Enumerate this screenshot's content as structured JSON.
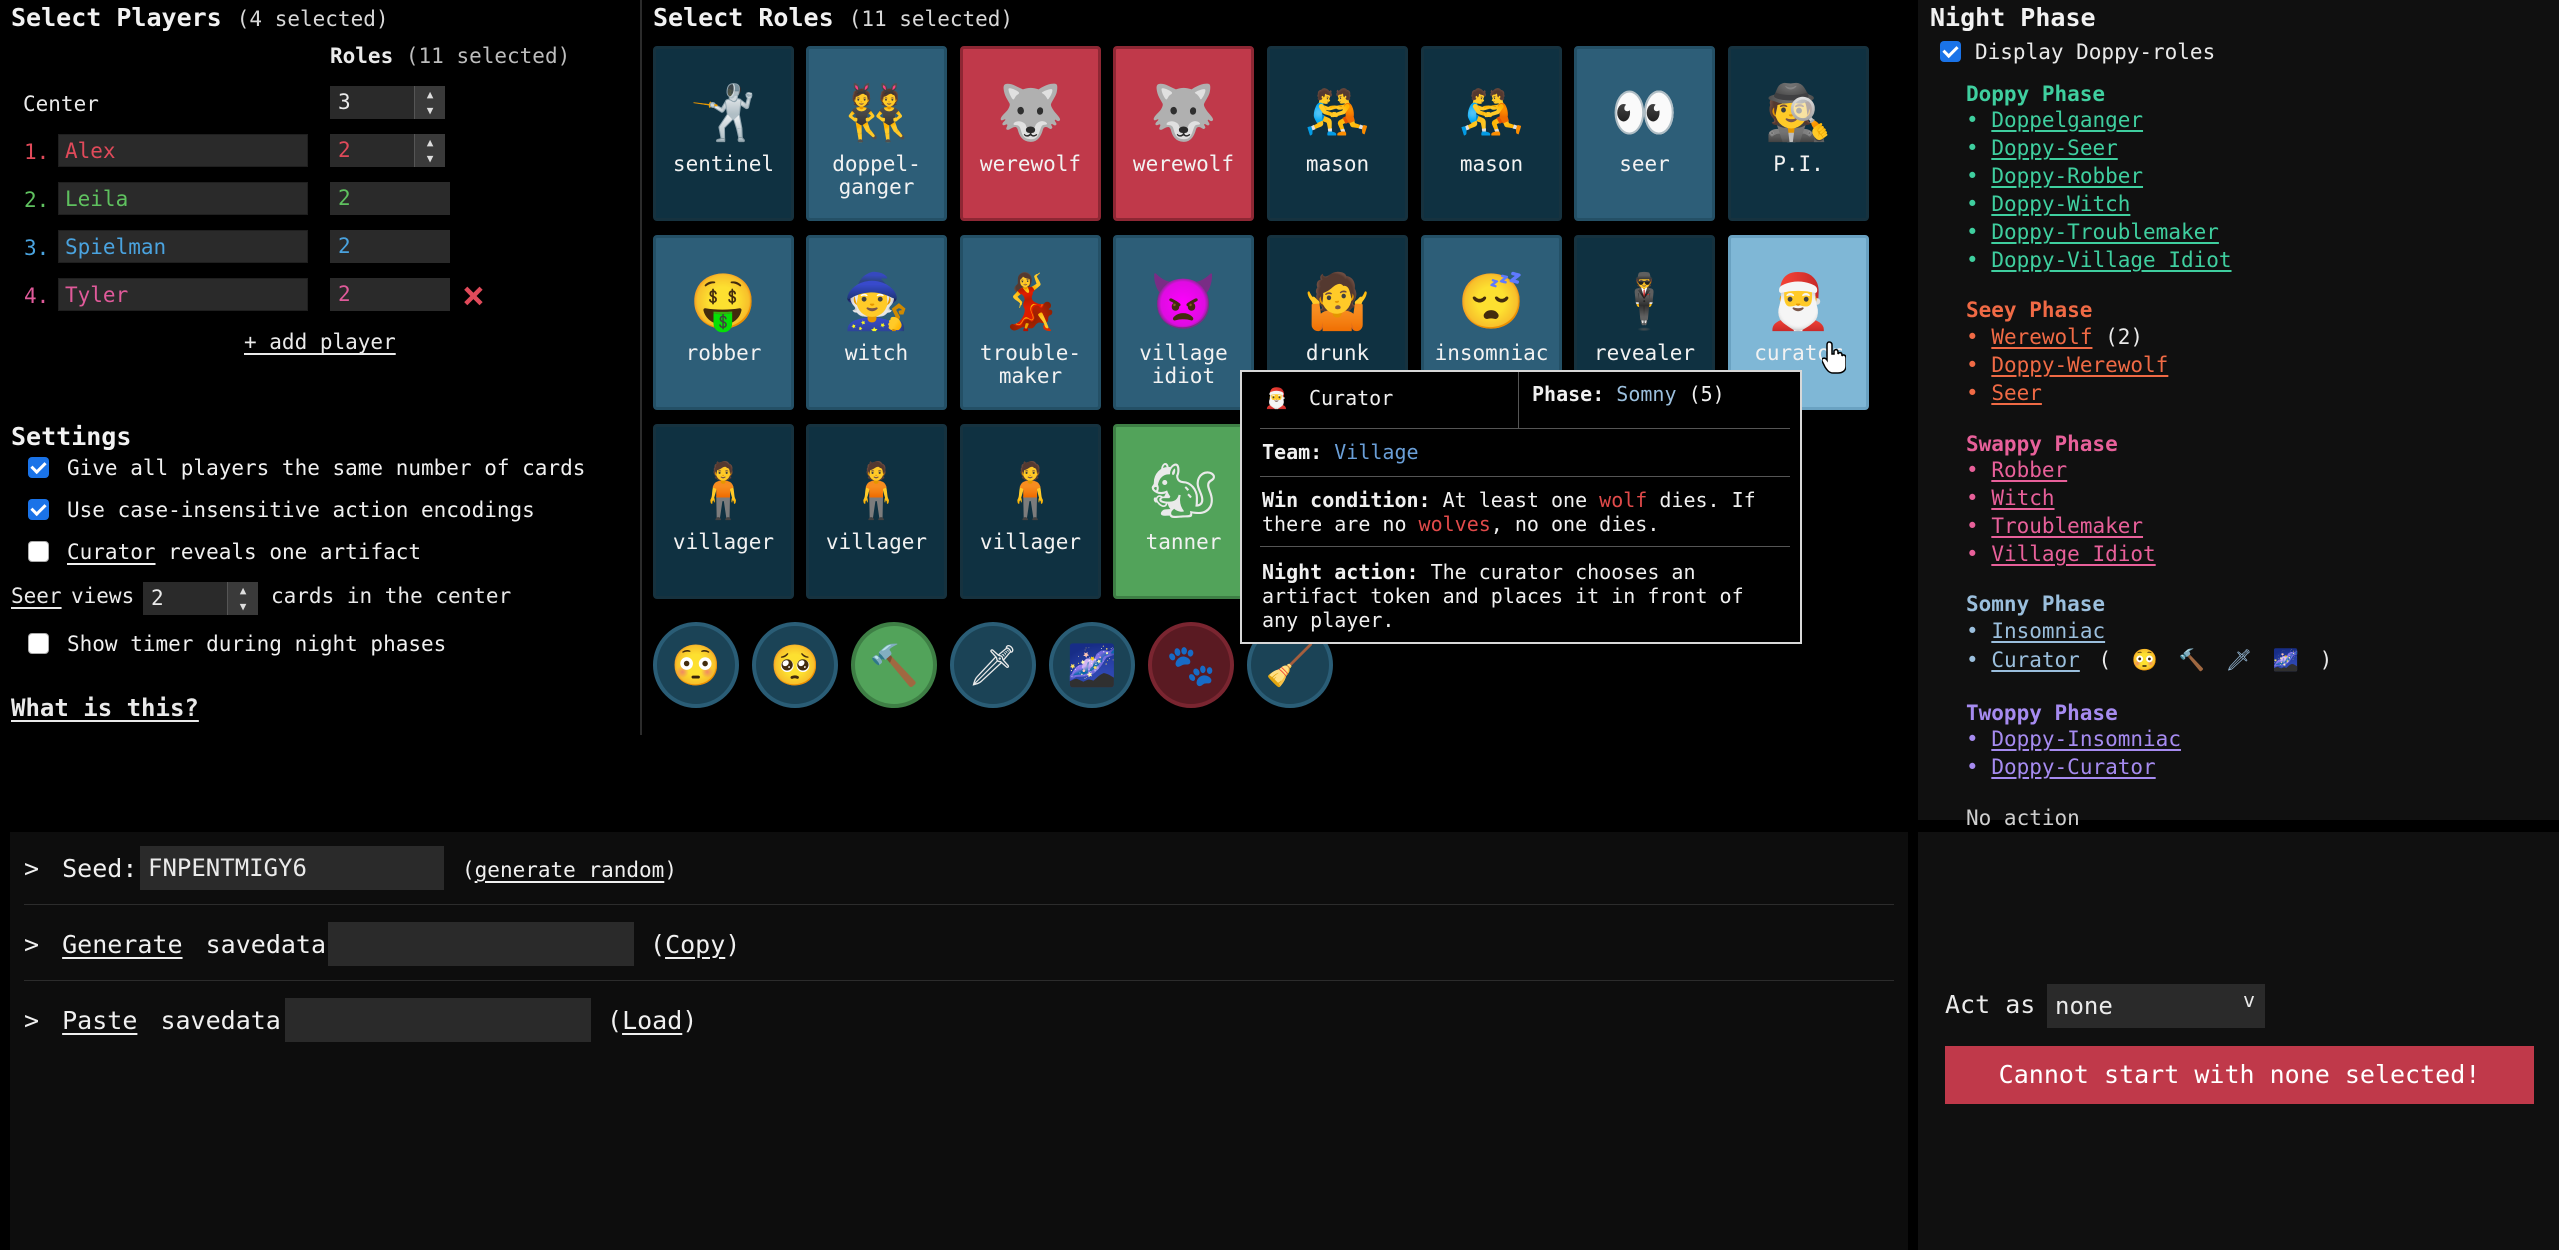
{
  "players": {
    "title": "Select Players",
    "count": "(4 selected)",
    "roles_header": "Roles",
    "roles_count": "(11 selected)",
    "center_label": "Center",
    "center_value": "3",
    "list": [
      {
        "num": "1.",
        "name": "Alex",
        "roles": "2",
        "color": "#e04a5a"
      },
      {
        "num": "2.",
        "name": "Leila",
        "roles": "2",
        "color": "#5fc15f"
      },
      {
        "num": "3.",
        "name": "Spielman",
        "roles": "2",
        "color": "#4aa3df"
      },
      {
        "num": "4.",
        "name": "Tyler",
        "roles": "2",
        "color": "#e05a9a"
      }
    ],
    "remove_icon": "×",
    "add_player": "+ add player"
  },
  "settings": {
    "title": "Settings",
    "same_cards": "Give all players the same number of cards",
    "case_insensitive": "Use case-insensitive action encodings",
    "curator_word": "Curator",
    "curator_rest": "reveals one artifact",
    "seer_word": "Seer",
    "seer_views": "views",
    "seer_value": "2",
    "seer_rest": "cards in the center",
    "timer": "Show timer during night phases",
    "what_is_this": "What is this?"
  },
  "roles": {
    "title": "Select Roles",
    "count": "(11 selected)",
    "cards": [
      {
        "emoji": "🤺",
        "label": "sentinel"
      },
      {
        "emoji": "👯",
        "label": "doppel-\nganger"
      },
      {
        "emoji": "🐺",
        "label": "werewolf"
      },
      {
        "emoji": "🐺",
        "label": "werewolf"
      },
      {
        "emoji": "🤼",
        "label": "mason"
      },
      {
        "emoji": "🤼",
        "label": "mason"
      },
      {
        "emoji": "👀",
        "label": "seer"
      },
      {
        "emoji": "🕵",
        "label": "P.I."
      },
      {
        "emoji": "🤑",
        "label": "robber"
      },
      {
        "emoji": "🧙",
        "label": "witch"
      },
      {
        "emoji": "💃",
        "label": "trouble-\nmaker"
      },
      {
        "emoji": "👿",
        "label": "village\nidiot"
      },
      {
        "emoji": "🤷",
        "label": "drunk"
      },
      {
        "emoji": "😴",
        "label": "insomniac"
      },
      {
        "emoji": "🕴",
        "label": "revealer"
      },
      {
        "emoji": "🎅",
        "label": "curator"
      },
      {
        "emoji": "🧍",
        "label": "villager"
      },
      {
        "emoji": "🧍",
        "label": "villager"
      },
      {
        "emoji": "🧍",
        "label": "villager"
      },
      {
        "emoji": "🐿",
        "label": "tanner"
      }
    ],
    "tokens": [
      "😳",
      "🥺",
      "🔨",
      "🗡",
      "🌌",
      "🐾",
      "🧹"
    ]
  },
  "tooltip": {
    "emoji": "🎅",
    "name": "Curator",
    "phase_label": "Phase:",
    "phase_value": "Somny",
    "phase_num": "(5)",
    "team_label": "Team:",
    "team_value": "Village",
    "win_label": "Win condition:",
    "win_a": "At least one",
    "win_wolf": "wolf",
    "win_b": "dies. If",
    "win_c": "there are no",
    "win_wolves": "wolves",
    "win_d": ", no one dies.",
    "night_label": "Night action:",
    "night_a": "The curator chooses an",
    "night_b": "artifact token and places it in front of",
    "night_c": "any player."
  },
  "night": {
    "title": "Night Phase",
    "display_doppy": "Display Doppy-roles",
    "doppy_title": "Doppy Phase",
    "doppy_items": [
      "Doppelganger",
      "Doppy-Seer",
      "Doppy-Robber",
      "Doppy-Witch",
      "Doppy-Troublemaker",
      "Doppy-Village Idiot"
    ],
    "seey_title": "Seey Phase",
    "seey_items": [
      "Werewolf",
      "Doppy-Werewolf",
      "Seer"
    ],
    "werewolf_count": "(2)",
    "swappy_title": "Swappy Phase",
    "swappy_items": [
      "Robber",
      "Witch",
      "Troublemaker",
      "Village Idiot"
    ],
    "somny_title": "Somny Phase",
    "somny_items": [
      "Insomniac",
      "Curator"
    ],
    "curator_tokens": [
      "😳",
      "🔨",
      "🗡",
      "🌌"
    ],
    "twoppy_title": "Twoppy Phase",
    "twoppy_items": [
      "Doppy-Insomniac",
      "Doppy-Curator"
    ],
    "no_action": "No action",
    "bullet": "•",
    "paren_open": "(",
    "paren_close": ")"
  },
  "bottom": {
    "prompt": ">",
    "seed_label": "Seed:",
    "seed_value": "FNPENTMIGY6",
    "generate_random": "generate random",
    "generate": "Generate",
    "savedata": "savedata:",
    "copy": "Copy",
    "paste": "Paste",
    "load": "Load",
    "lparen": "(",
    "rparen": ")"
  },
  "act": {
    "label": "Act as",
    "value": "none",
    "arrow": "v",
    "start_msg": "Cannot start with none selected!"
  },
  "colors": {
    "doppy": "#3fcf9f",
    "seey": "#f06a45",
    "swappy": "#e8609a",
    "somny": "#9bbfdd",
    "twoppy": "#a68bf0",
    "red": "#e04a4a",
    "blue": "#6a9fd8"
  }
}
